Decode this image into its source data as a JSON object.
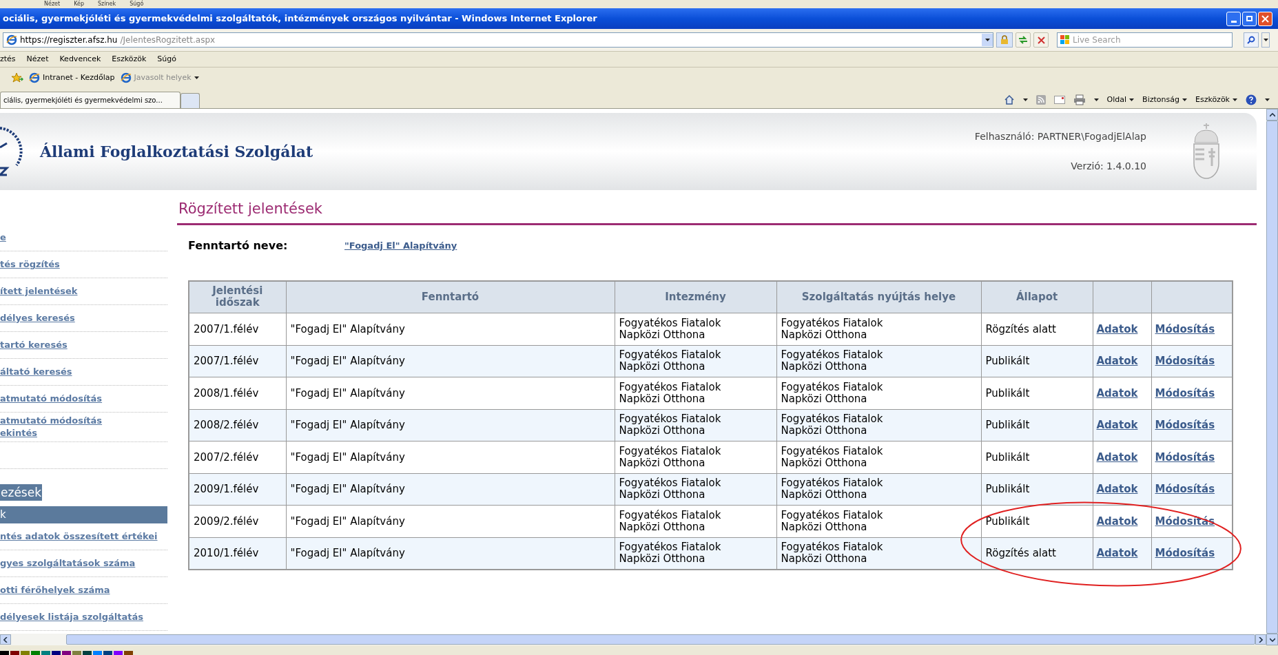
{
  "background_menu": [
    "Nézet",
    "Kép",
    "Színek",
    "Súgó"
  ],
  "window": {
    "title": "ociális, gyermekjóléti és gyermekvédelmi szolgáltatók, intézmények országos nyilvántar - Windows Internet Explorer"
  },
  "address": {
    "scheme": "https://",
    "host": "regiszter.afsz.hu",
    "path": "/JelentesRogzitett.aspx"
  },
  "search": {
    "placeholder": "Live Search"
  },
  "menu": [
    "ztés",
    "Nézet",
    "Kedvencek",
    "Eszközök",
    "Súgó"
  ],
  "favorites": [
    "Intranet - Kezdőlap",
    "Javasolt helyek"
  ],
  "tab": {
    "title": "ciális, gyermekjóléti és gyermekvédelmi szo..."
  },
  "command_bar": [
    "Oldal",
    "Biztonság",
    "Eszközök"
  ],
  "header": {
    "logo_text": "Állami Foglalkoztatási Szolgálat",
    "user": "Felhasználó: PARTNER\\FogadjElAlap",
    "version": "Verzió: 1.4.0.10"
  },
  "sidebar": [
    {
      "kind": "link",
      "label": "e"
    },
    {
      "kind": "link",
      "label": "tés rögzítés"
    },
    {
      "kind": "link",
      "label": "ített jelentések"
    },
    {
      "kind": "link",
      "label": "délyes keresés"
    },
    {
      "kind": "link",
      "label": "tartó keresés"
    },
    {
      "kind": "link",
      "label": "áltató keresés"
    },
    {
      "kind": "link",
      "label": "atmutató módosítás"
    },
    {
      "kind": "link",
      "label": "atmutató módosítás\nekintés"
    },
    {
      "kind": "blank"
    },
    {
      "kind": "section",
      "label": "ezések"
    },
    {
      "kind": "bar",
      "label": "k"
    },
    {
      "kind": "link",
      "label": "ntés adatok összesített értékei"
    },
    {
      "kind": "link",
      "label": "gyes szolgáltatások száma"
    },
    {
      "kind": "link",
      "label": "otti férőhelyek száma"
    },
    {
      "kind": "link",
      "label": "délyesek listája szolgáltatás"
    }
  ],
  "page_title": "Rögzített jelentések",
  "owner": {
    "label": "Fenntartó neve:",
    "value": "\"Fogadj El\" Alapítvány"
  },
  "table": {
    "columns": [
      "Jelentési időszak",
      "Fenntartó",
      "Intezmény",
      "Szolgáltatás nyújtás helye",
      "Állapot"
    ],
    "rows": [
      {
        "period": "2007/1.félév",
        "owner": "\"Fogadj El\" Alapítvány",
        "institution": "Fogyatékos Fiatalok\nNapközi Otthona",
        "place": "Fogyatékos Fiatalok\nNapközi Otthona",
        "status": "Rögzítés alatt",
        "data_link": "Adatok",
        "edit_link": "Módosítás"
      },
      {
        "period": "2007/1.félév",
        "owner": "\"Fogadj El\" Alapítvány",
        "institution": "Fogyatékos Fiatalok\nNapközi Otthona",
        "place": "Fogyatékos Fiatalok\nNapközi Otthona",
        "status": "Publikált",
        "data_link": "Adatok",
        "edit_link": "Módosítás"
      },
      {
        "period": "2008/1.félév",
        "owner": "\"Fogadj El\" Alapítvány",
        "institution": "Fogyatékos Fiatalok\nNapközi Otthona",
        "place": "Fogyatékos Fiatalok\nNapközi Otthona",
        "status": "Publikált",
        "data_link": "Adatok",
        "edit_link": "Módosítás"
      },
      {
        "period": "2008/2.félév",
        "owner": "\"Fogadj El\" Alapítvány",
        "institution": "Fogyatékos Fiatalok\nNapközi Otthona",
        "place": "Fogyatékos Fiatalok\nNapközi Otthona",
        "status": "Publikált",
        "data_link": "Adatok",
        "edit_link": "Módosítás"
      },
      {
        "period": "2007/2.félév",
        "owner": "\"Fogadj El\" Alapítvány",
        "institution": "Fogyatékos Fiatalok\nNapközi Otthona",
        "place": "Fogyatékos Fiatalok\nNapközi Otthona",
        "status": "Publikált",
        "data_link": "Adatok",
        "edit_link": "Módosítás"
      },
      {
        "period": "2009/1.félév",
        "owner": "\"Fogadj El\" Alapítvány",
        "institution": "Fogyatékos Fiatalok\nNapközi Otthona",
        "place": "Fogyatékos Fiatalok\nNapközi Otthona",
        "status": "Publikált",
        "data_link": "Adatok",
        "edit_link": "Módosítás"
      },
      {
        "period": "2009/2.félév",
        "owner": "\"Fogadj El\" Alapítvány",
        "institution": "Fogyatékos Fiatalok\nNapközi Otthona",
        "place": "Fogyatékos Fiatalok\nNapközi Otthona",
        "status": "Publikált",
        "data_link": "Adatok",
        "edit_link": "Módosítás"
      },
      {
        "period": "2010/1.félév",
        "owner": "\"Fogadj El\" Alapítvány",
        "institution": "Fogyatékos Fiatalok\nNapközi Otthona",
        "place": "Fogyatékos Fiatalok\nNapközi Otthona",
        "status": "Rögzítés alatt",
        "data_link": "Adatok",
        "edit_link": "Módosítás"
      }
    ]
  }
}
